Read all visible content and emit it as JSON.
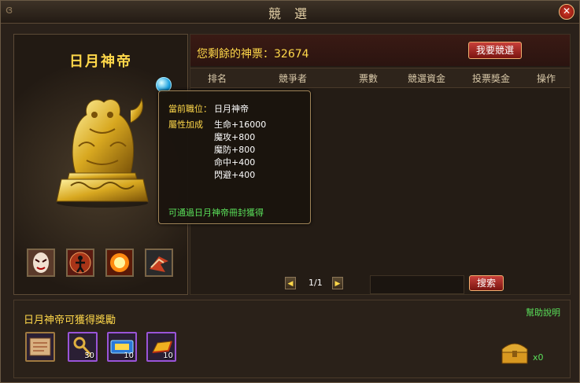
{
  "window": {
    "title": "競 選"
  },
  "hero": {
    "title": "日月神帝",
    "skills": [
      "mask-skill-icon",
      "figure-skill-icon",
      "explosion-skill-icon",
      "bird-skill-icon"
    ]
  },
  "votes": {
    "label": "您剩餘的神票：32674",
    "button": "我要競選"
  },
  "table": {
    "headers": [
      "排名",
      "競爭者",
      "票數",
      "競選資金",
      "投票獎金",
      "操作"
    ]
  },
  "pager": {
    "page": "1/1",
    "search_button": "搜索",
    "search_value": ""
  },
  "tooltip": {
    "position_label": "當前職位：",
    "position_value": "日月神帝",
    "attr_label": "屬性加成",
    "attrs": [
      "生命+16000",
      "魔攻+800",
      "魔防+800",
      "命中+400",
      "閃避+400"
    ],
    "note": "可通過日月神帝冊封獲得"
  },
  "rewards": {
    "title": "日月神帝可獲得獎勵",
    "help": "幫助說明",
    "items": [
      {
        "name": "scroll",
        "count": ""
      },
      {
        "name": "key",
        "count": "30"
      },
      {
        "name": "ticket",
        "count": "10"
      },
      {
        "name": "gold-bar",
        "count": "10"
      }
    ],
    "chest_count": "x0"
  },
  "colors": {
    "gold": "#ffd84a",
    "green": "#5ae05a",
    "red_button": "#c8403a"
  }
}
